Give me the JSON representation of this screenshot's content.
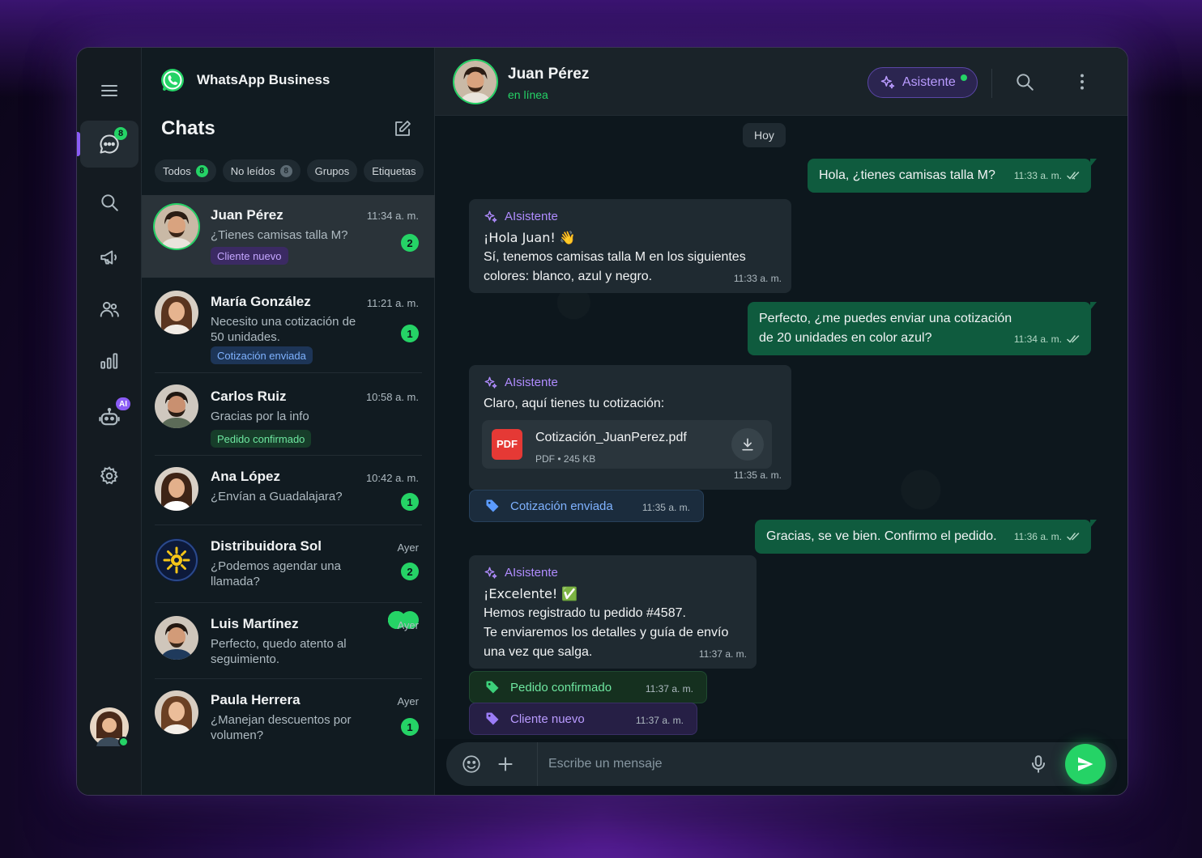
{
  "app": {
    "name": "WhatsApp Business"
  },
  "rail": {
    "chats_badge": "8",
    "ai_badge": "AI"
  },
  "list": {
    "title": "Chats",
    "filters": [
      {
        "label": "Todos",
        "count": "8"
      },
      {
        "label": "No leídos",
        "count": "8"
      },
      {
        "label": "Grupos"
      },
      {
        "label": "Etiquetas"
      }
    ],
    "chats": [
      {
        "name": "Juan Pérez",
        "time": "11:34 a. m.",
        "message": "¿Tienes camisas talla M?",
        "unread": "2",
        "tag": "Cliente nuevo"
      },
      {
        "name": "María González",
        "time": "11:21 a. m.",
        "message": "Necesito una cotización de 50 unidades.",
        "unread": "1",
        "tag": "Cotización enviada"
      },
      {
        "name": "Carlos Ruiz",
        "time": "10:58 a. m.",
        "message": "Gracias por la info",
        "tag": "Pedido confirmado"
      },
      {
        "name": "Ana López",
        "time": "10:42 a. m.",
        "message": "¿Envían a Guadalajara?",
        "unread": "1"
      },
      {
        "name": "Distribuidora Sol",
        "time": "Ayer",
        "message": "¿Podemos agendar una llamada?",
        "unread": "2"
      },
      {
        "name": "Luis Martínez",
        "time": "Ayer",
        "message": "Perfecto, quedo atento al seguimiento."
      },
      {
        "name": "Paula Herrera",
        "time": "Ayer",
        "message": "¿Manejan descuentos por volumen?",
        "unread": "1"
      }
    ]
  },
  "header": {
    "name": "Juan Pérez",
    "status": "en línea",
    "assistant_label": "Asistente"
  },
  "conversation": {
    "day": "Hoy",
    "messages": [
      {
        "dir": "out",
        "text": "Hola, ¿tienes camisas talla M?",
        "time": "11:33 a. m."
      },
      {
        "dir": "in",
        "sender": "AIsistente",
        "line1": "¡Hola Juan! 👋",
        "line2": "Sí, tenemos camisas talla M en los siguientes",
        "line3": "colores: blanco, azul y negro.",
        "time": "11:33 a. m."
      },
      {
        "dir": "out",
        "line1": "Perfecto, ¿me puedes enviar una cotización",
        "line2": "de 20 unidades en color azul?",
        "time": "11:34 a. m."
      },
      {
        "dir": "in",
        "sender": "AIsistente",
        "text": "Claro, aquí tienes tu cotización:",
        "file_name": "Cotización_JuanPerez.pdf",
        "file_meta": "PDF • 245 KB",
        "file_icon": "PDF",
        "time": "11:35 a. m."
      },
      {
        "label": "Cotización enviada",
        "time": "11:35 a. m."
      },
      {
        "dir": "out",
        "text": "Gracias, se ve bien. Confirmo el pedido.",
        "time": "11:36 a. m."
      },
      {
        "dir": "in",
        "sender": "AIsistente",
        "line1": "¡Excelente! ✅",
        "line2": "Hemos registrado tu pedido #4587.",
        "line3": "Te enviaremos los detalles y guía de envío",
        "line4": "una vez que salga.",
        "time": "11:37 a. m."
      },
      {
        "label": "Pedido confirmado",
        "time": "11:37 a. m."
      },
      {
        "label": "Cliente nuevo",
        "time": "11:37 a. m."
      }
    ]
  },
  "composer": {
    "placeholder": "Escribe un mensaje"
  },
  "colors": {
    "accent_green": "#25d366",
    "accent_purple": "#8b5cf6",
    "outgoing_bubble": "#0f5b3e",
    "incoming_bubble": "#1f2a31"
  }
}
